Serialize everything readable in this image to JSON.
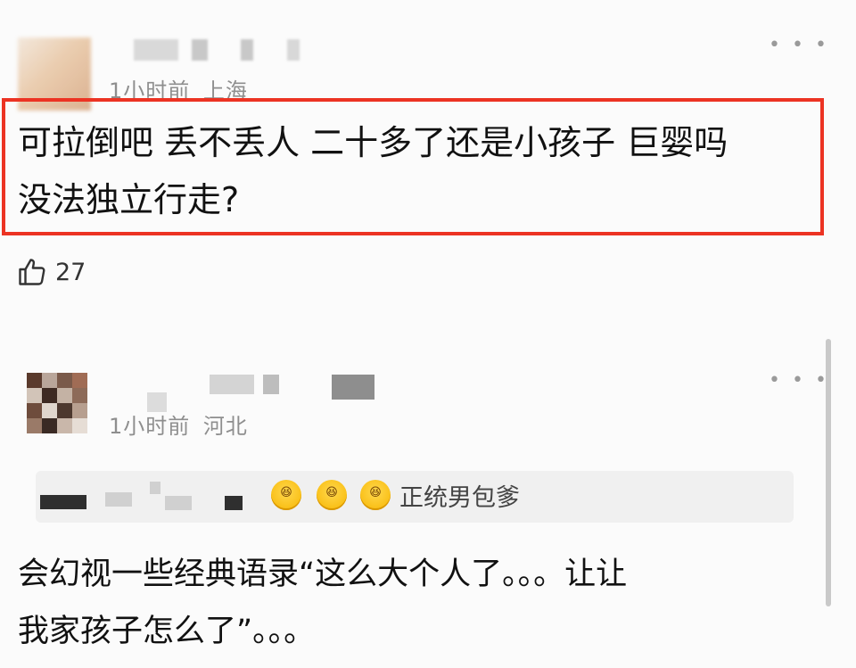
{
  "comment1": {
    "meta_time": "1小时前",
    "meta_location": "上海",
    "text_line1": "可拉倒吧 丢不丢人 二十多了还是小孩子 巨婴吗",
    "text_line2": "没法独立行走?",
    "like_count": "27"
  },
  "comment2": {
    "meta_time": "1小时前",
    "meta_location": "河北",
    "quote_emojis": [
      "😆",
      "😆",
      "😆"
    ],
    "quote_text": "正统男包爹",
    "text_line1": "会幻视一些经典语录“这么大个人了。。。让让",
    "text_line2": "我家孩子怎么了”。。。"
  },
  "icons": {
    "more": "more-horizontal-icon",
    "like": "thumbs-up-icon"
  },
  "colors": {
    "highlight": "#ec3323",
    "meta": "#8e8e8e"
  }
}
